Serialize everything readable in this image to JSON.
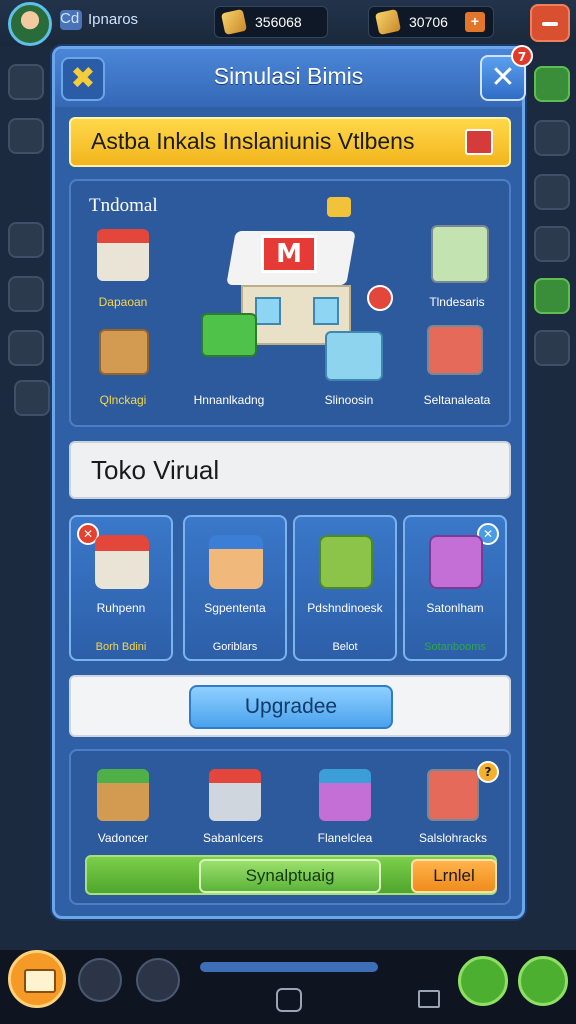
{
  "hud": {
    "player_name": "Ipnaros",
    "tag": "Cd",
    "resource1": "356068",
    "resource2": "30706",
    "plus": "+"
  },
  "panel": {
    "title": "Simulasi Bimis",
    "close_badge": "7",
    "banner": "Astba Inkals Inslaniunis Vtlbens",
    "business_section_title": "Tndomal",
    "business_items": [
      {
        "label": "Dapaoan",
        "color": "yellow"
      },
      {
        "label": "Qlnckagi",
        "color": "yellow"
      },
      {
        "label": "Hnnanlkadng",
        "color": "white"
      },
      {
        "label": "Slinoosin",
        "color": "white"
      },
      {
        "label": "Tlndesaris",
        "color": "white"
      },
      {
        "label": "Seltanaleata",
        "color": "white"
      }
    ],
    "store_title": "Toko Virual",
    "cards": [
      {
        "name": "Ruhpenn",
        "sub": "Borh Bdini",
        "sub_color": "#f7d74a"
      },
      {
        "name": "Sgpententa",
        "sub": "Goriblars",
        "sub_color": "#ffffff"
      },
      {
        "name": "Pdshndinoesk",
        "sub": "Belot",
        "sub_color": "#ffffff"
      },
      {
        "name": "Satonlham",
        "sub": "Sotanbooms",
        "sub_color": "#2fa84a"
      }
    ],
    "upgrade_button": "Upgradee",
    "bottom_items": [
      {
        "label": "Vadoncer"
      },
      {
        "label": "Sabanlcers"
      },
      {
        "label": "Flanelclea"
      },
      {
        "label": "Salslohracks"
      }
    ],
    "sync_button": "Synalptuaig",
    "orange_button": "Lrnlel"
  },
  "colors": {
    "panel": "#2f5fa4",
    "banner": "#ffd84a",
    "accent_orange": "#f08b1d",
    "accent_green": "#5cb33a"
  }
}
